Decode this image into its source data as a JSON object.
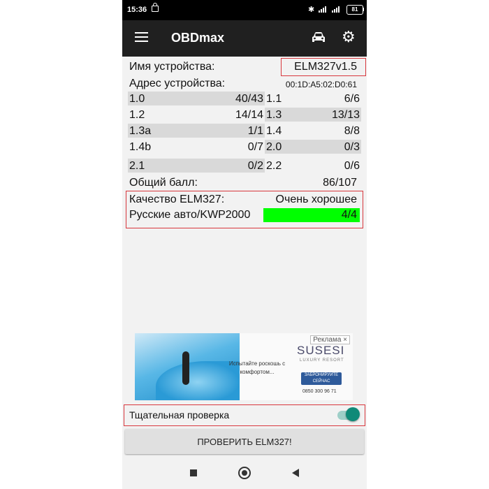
{
  "status_bar": {
    "time": "15:36",
    "battery": "81",
    "icons": [
      "lock-icon",
      "bluetooth-icon",
      "signal-icon",
      "battery-icon"
    ]
  },
  "app_bar": {
    "title": "OBDmax",
    "icons": [
      "menu-icon",
      "car-icon",
      "gear-icon"
    ]
  },
  "device": {
    "name_label": "Имя устройства:",
    "name_value": "ELM327v1.5",
    "address_label": "Адрес устройства:",
    "address_value": "00:1D:A5:02:D0:61"
  },
  "tests": [
    {
      "left_key": "1.0",
      "left_val": "40/43",
      "right_key": "1.1",
      "right_val": "6/6"
    },
    {
      "left_key": "1.2",
      "left_val": "14/14",
      "right_key": "1.3",
      "right_val": "13/13"
    },
    {
      "left_key": "1.3a",
      "left_val": "1/1",
      "right_key": "1.4",
      "right_val": "8/8"
    },
    {
      "left_key": "1.4b",
      "left_val": "0/7",
      "right_key": "2.0",
      "right_val": "0/3"
    },
    {
      "left_key": "2.1",
      "left_val": "0/2",
      "right_key": "2.2",
      "right_val": "0/6"
    }
  ],
  "total": {
    "label": "Общий балл:",
    "value": "86/107"
  },
  "quality": {
    "label": "Качество ELM327:",
    "value": "Очень хорошее"
  },
  "russian": {
    "label": "Русские авто/KWP2000",
    "value": "4/4",
    "highlight_color": "#00ff00"
  },
  "ad": {
    "badge": "Реклама ×",
    "slogan": "Испытайте роскошь с комфортом...",
    "brand": "SUSESI",
    "brand_sub": "LUXURY RESORT",
    "cta": "ЗАБРОНИРУЙТЕ СЕЙЧАС",
    "phone": "0850 300 96 71"
  },
  "thorough_check": {
    "label": "Тщательная проверка",
    "enabled": true
  },
  "check_button": {
    "label": "ПРОВЕРИТЬ ELM327!"
  },
  "colors": {
    "highlight_border": "#d8373d",
    "accent": "#0f8a78",
    "app_bar": "#202020"
  }
}
